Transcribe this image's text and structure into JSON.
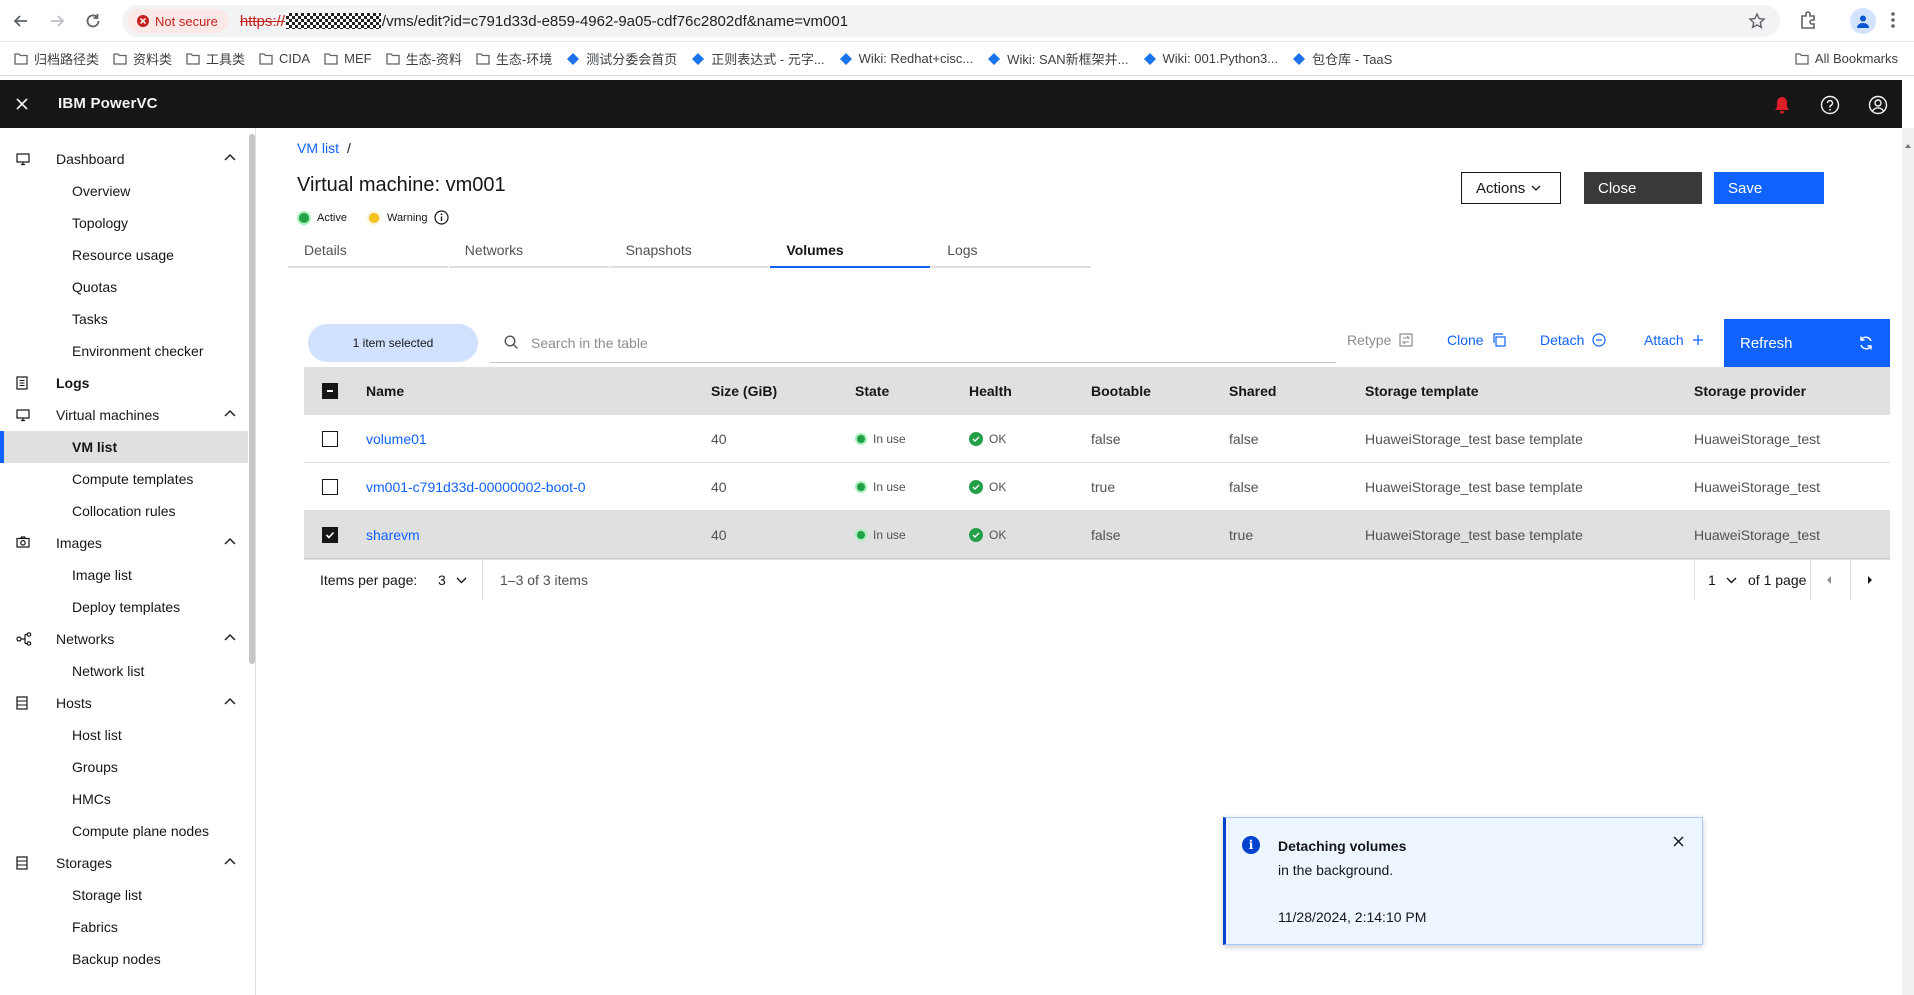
{
  "browser": {
    "not_secure": "Not secure",
    "url_scheme": "https://",
    "url_path": "/vms/edit?id=c791d33d-e859-4962-9a05-cdf76c2802df&name=vm001",
    "bookmarks": [
      "归档路径类",
      "资料类",
      "工具类",
      "CIDA",
      "MEF",
      "生态-资料",
      "生态-环境",
      "测试分委会首页",
      "正则表达式 - 元字...",
      "Wiki: Redhat+cisc...",
      "Wiki: SAN新框架并...",
      "Wiki: 001.Python3...",
      "包仓库 - TaaS"
    ],
    "all_bookmarks": "All Bookmarks"
  },
  "app": {
    "name": "IBM PowerVC"
  },
  "sidebar": {
    "dashboard": {
      "label": "Dashboard",
      "items": [
        "Overview",
        "Topology",
        "Resource usage",
        "Quotas",
        "Tasks",
        "Environment checker"
      ]
    },
    "logs": {
      "label": "Logs"
    },
    "vms": {
      "label": "Virtual machines",
      "items": [
        "VM list",
        "Compute templates",
        "Collocation rules"
      ]
    },
    "images": {
      "label": "Images",
      "items": [
        "Image list",
        "Deploy templates"
      ]
    },
    "networks": {
      "label": "Networks",
      "items": [
        "Network list"
      ]
    },
    "hosts": {
      "label": "Hosts",
      "items": [
        "Host list",
        "Groups",
        "HMCs",
        "Compute plane nodes"
      ]
    },
    "storages": {
      "label": "Storages",
      "items": [
        "Storage list",
        "Fabrics",
        "Backup nodes"
      ]
    }
  },
  "page": {
    "breadcrumb": "VM list",
    "breadcrumb_sep": "/",
    "title": "Virtual machine: vm001",
    "status_active": "Active",
    "status_warning": "Warning",
    "actions_label": "Actions",
    "close_label": "Close",
    "save_label": "Save",
    "tabs": [
      "Details",
      "Networks",
      "Snapshots",
      "Volumes",
      "Logs"
    ]
  },
  "toolbar": {
    "selected": "1 item selected",
    "search_placeholder": "Search in the table",
    "retype": "Retype",
    "clone": "Clone",
    "detach": "Detach",
    "attach": "Attach",
    "refresh": "Refresh"
  },
  "table": {
    "headers": [
      "Name",
      "Size (GiB)",
      "State",
      "Health",
      "Bootable",
      "Shared",
      "Storage template",
      "Storage provider"
    ],
    "rows": [
      {
        "name": "volume01",
        "size": "40",
        "state": "In use",
        "health": "OK",
        "bootable": "false",
        "shared": "false",
        "template": "HuaweiStorage_test base template",
        "provider": "HuaweiStorage_test"
      },
      {
        "name": "vm001-c791d33d-00000002-boot-0",
        "size": "40",
        "state": "In use",
        "health": "OK",
        "bootable": "true",
        "shared": "false",
        "template": "HuaweiStorage_test base template",
        "provider": "HuaweiStorage_test"
      },
      {
        "name": "sharevm",
        "size": "40",
        "state": "In use",
        "health": "OK",
        "bootable": "false",
        "shared": "true",
        "template": "HuaweiStorage_test base template",
        "provider": "HuaweiStorage_test"
      }
    ]
  },
  "pagination": {
    "items_per_page_label": "Items per page:",
    "items_per_page": "3",
    "range": "1–3 of 3 items",
    "page": "1",
    "of_pages": "of 1 page"
  },
  "toast": {
    "title": "Detaching volumes",
    "subtitle": "in the background.",
    "timestamp": "11/28/2024, 2:14:10 PM"
  },
  "colors": {
    "accent": "#0f62fe",
    "header_bg": "#161616",
    "success": "#24a148",
    "warning": "#f1c21b",
    "notification": "#da1e28"
  }
}
